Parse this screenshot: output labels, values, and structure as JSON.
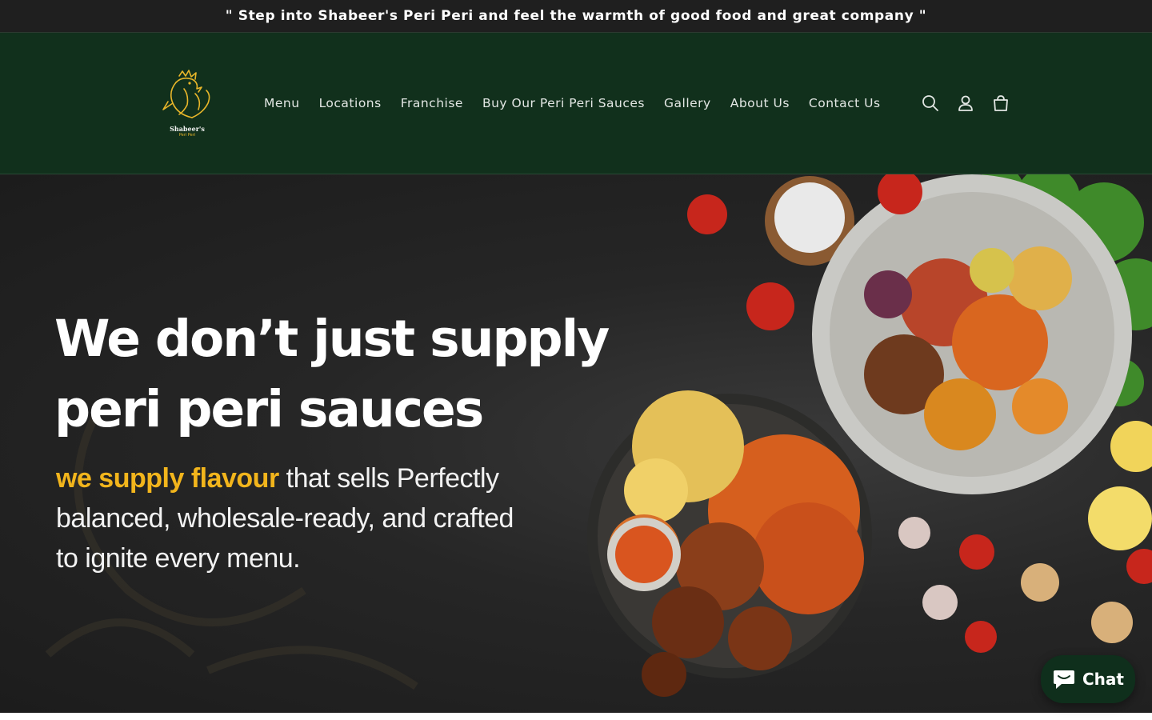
{
  "announcement": {
    "text": "\" Step into Shabeer's Peri Peri and feel the warmth of good food and great company \""
  },
  "logo": {
    "name": "Shabeer's",
    "subtitle": "Peri Peri",
    "icon": "rooster-logo-icon"
  },
  "nav": {
    "items": [
      {
        "label": "Menu"
      },
      {
        "label": "Locations"
      },
      {
        "label": "Franchise"
      },
      {
        "label": "Buy Our Peri Peri Sauces"
      },
      {
        "label": "Gallery"
      },
      {
        "label": "About Us"
      },
      {
        "label": "Contact Us"
      }
    ]
  },
  "header_icons": [
    "search-icon",
    "account-icon",
    "cart-icon"
  ],
  "hero": {
    "headline_line1": "We don’t just supply",
    "headline_line2": "peri peri sauces",
    "sub_accent": "we supply flavour",
    "sub_rest": " that sells Perfectly balanced, wholesale-ready, and crafted to ignite every menu."
  },
  "chat": {
    "label": "Chat",
    "icon": "chat-bubble-icon"
  },
  "colors": {
    "announcement_bg": "#1f1f1f",
    "header_bg": "#11301c",
    "accent_gold": "#f2b51c",
    "hero_bg": "#262626",
    "chat_bg": "#0f2f1c"
  }
}
